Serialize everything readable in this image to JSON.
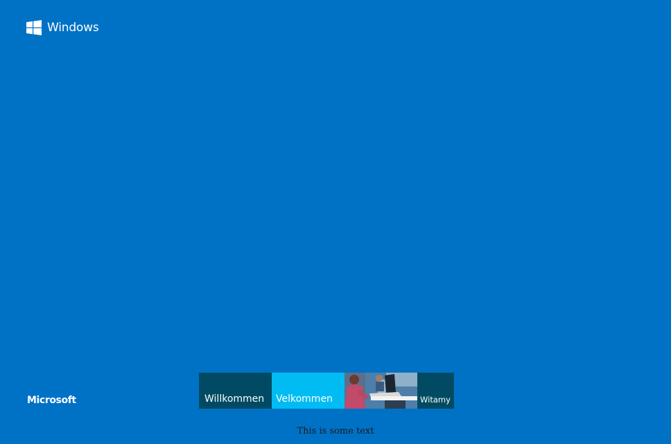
{
  "header": {
    "brand": "Windows",
    "logo_icon": "windows-logo-icon"
  },
  "footer": {
    "company": "Microsoft"
  },
  "tiles": [
    {
      "label": "Willkommen",
      "color": "#004B63"
    },
    {
      "label": "Velkommen",
      "color": "#00BCF2"
    },
    {
      "label": "",
      "image": "person-with-laptop-photo"
    },
    {
      "label": "Witamy",
      "color": "#004B63"
    }
  ],
  "caption": "This is some text",
  "colors": {
    "background": "#0072C6",
    "text": "#FFFFFF"
  }
}
